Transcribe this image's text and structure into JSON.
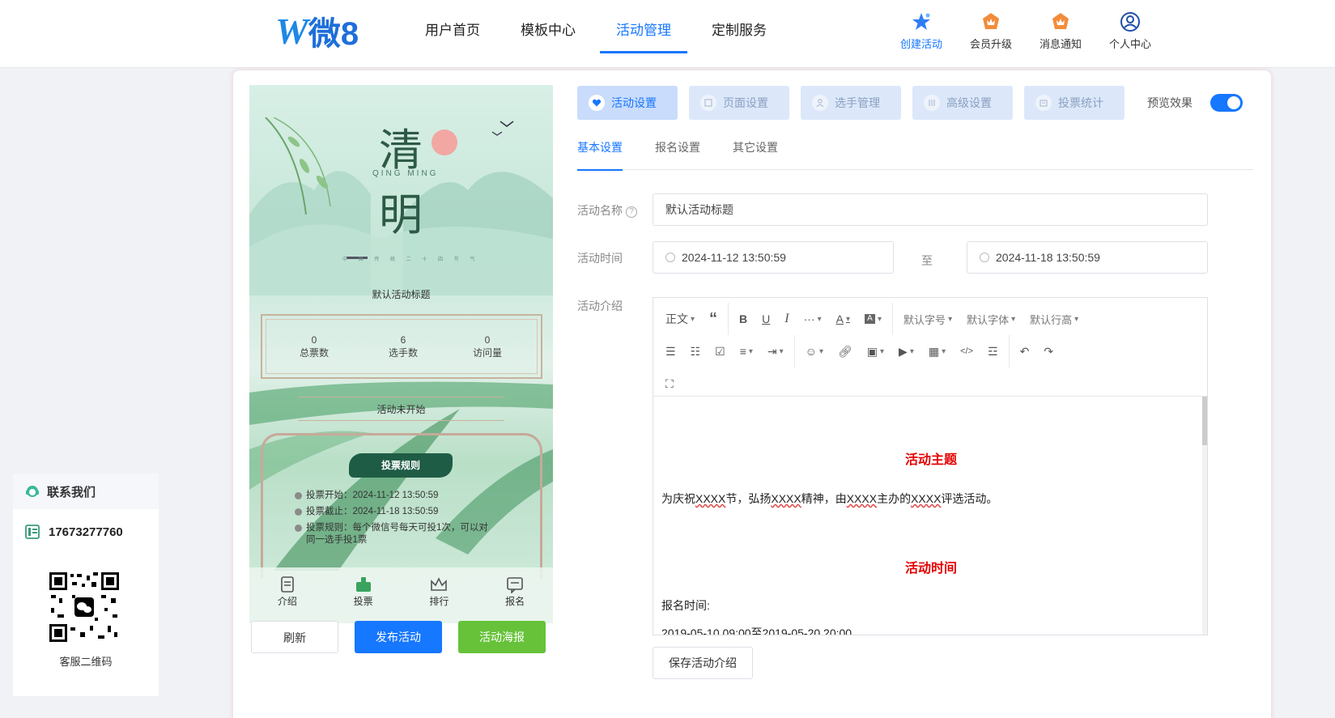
{
  "header": {
    "logo_text": "微8",
    "nav": [
      "用户首页",
      "模板中心",
      "活动管理",
      "定制服务"
    ],
    "nav_active_index": 2,
    "tools": [
      {
        "label": "创建活动",
        "icon": "create-activity-star-icon"
      },
      {
        "label": "会员升级",
        "icon": "member-upgrade-crown-icon"
      },
      {
        "label": "消息通知",
        "icon": "notification-crown-icon"
      },
      {
        "label": "个人中心",
        "icon": "user-circle-icon"
      }
    ]
  },
  "phone": {
    "title_char_1": "清",
    "title_char_2": "明",
    "title_en": "QING MING",
    "tagline_small": "中 国 传 统 二 十 四 节 气",
    "activity_title": "默认活动标题",
    "stats": [
      {
        "value": "0",
        "label": "总票数"
      },
      {
        "value": "6",
        "label": "选手数"
      },
      {
        "value": "0",
        "label": "访问量"
      }
    ],
    "status": "活动未开始",
    "rule_button": "投票规则",
    "rules": [
      "投票开始：2024-11-12 13:50:59",
      "投票截止：2024-11-18 13:50:59",
      "投票规则：每个微信号每天可投1次，可以对同一选手投1票"
    ],
    "tabbar": [
      {
        "label": "介绍",
        "icon": "intro-doc-icon"
      },
      {
        "label": "投票",
        "icon": "vote-thumb-icon"
      },
      {
        "label": "排行",
        "icon": "rank-crown-icon"
      },
      {
        "label": "报名",
        "icon": "signup-form-icon"
      }
    ]
  },
  "actions": {
    "refresh": "刷新",
    "publish": "发布活动",
    "poster": "活动海报"
  },
  "settings": {
    "tabs": [
      "活动设置",
      "页面设置",
      "选手管理",
      "高级设置",
      "投票统计"
    ],
    "active_tab_index": 0,
    "preview_label": "预览效果",
    "preview_on": true,
    "sub_tabs": [
      "基本设置",
      "报名设置",
      "其它设置"
    ],
    "active_sub_tab_index": 0,
    "form": {
      "name_label": "活动名称",
      "name_value": "默认活动标题",
      "time_label": "活动时间",
      "time_start": "2024-11-12 13:50:59",
      "time_sep": "至",
      "time_end": "2024-11-18 13:50:59",
      "intro_label": "活动介绍"
    },
    "editor_toolbar": {
      "paragraph": "正文",
      "font_size": "默认字号",
      "font_family": "默认字体",
      "line_height": "默认行高"
    },
    "editor_content": {
      "heading_1": "活动主题",
      "para_1": "为庆祝XXXX节，弘扬XXXX精神，由XXXX主办的XXXX评选活动。",
      "heading_2": "活动时间",
      "para_2": "报名时间:",
      "para_3": "2019-05-10 09:00至2019-05-20 20:00"
    },
    "save_button": "保存活动介绍"
  },
  "contact": {
    "title": "联系我们",
    "phone": "17673277760",
    "qr_label": "客服二维码"
  },
  "colors": {
    "primary": "#1677ff",
    "green": "#67c23a",
    "red_heading": "#e60000",
    "phone_button": "#1f5c46"
  }
}
